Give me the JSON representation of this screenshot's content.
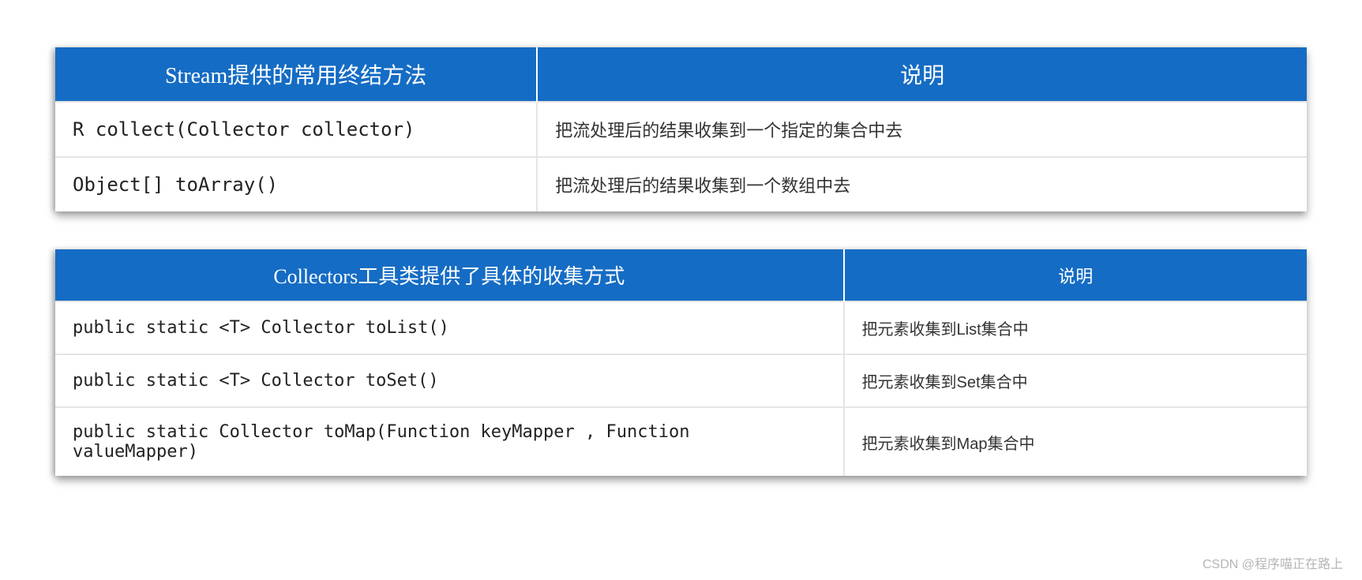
{
  "table1": {
    "headers": [
      "Stream提供的常用终结方法",
      "说明"
    ],
    "rows": [
      {
        "method": "R collect(Collector collector)",
        "desc": "把流处理后的结果收集到一个指定的集合中去"
      },
      {
        "method": "Object[] toArray()",
        "desc": "把流处理后的结果收集到一个数组中去"
      }
    ]
  },
  "table2": {
    "headers": [
      "Collectors工具类提供了具体的收集方式",
      "说明"
    ],
    "rows": [
      {
        "method": "public static <T> Collector toList()",
        "desc": "把元素收集到List集合中"
      },
      {
        "method": "public static <T> Collector toSet()",
        "desc": "把元素收集到Set集合中"
      },
      {
        "method": "public static  Collector toMap(Function keyMapper , Function valueMapper)",
        "desc": "把元素收集到Map集合中"
      }
    ]
  },
  "watermark": "CSDN @程序喵正在路上"
}
